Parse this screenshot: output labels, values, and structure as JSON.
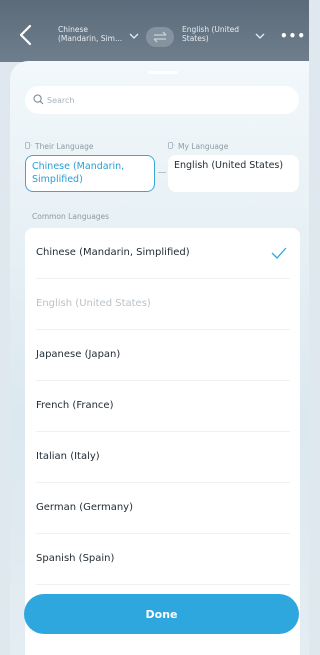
{
  "header": {
    "source_language": "Chinese (Mandarin, Sim...",
    "target_language": "English (United States)",
    "more_label": "•••"
  },
  "search": {
    "placeholder": "Search",
    "value": ""
  },
  "selection": {
    "their_label": "Their Language",
    "my_label": "My Language",
    "their_value": "Chinese (Mandarin, Simplified)",
    "my_value": "English (United States)"
  },
  "common_title": "Common Languages",
  "languages": [
    {
      "label": "Chinese (Mandarin, Simplified)",
      "selected": true,
      "disabled": false
    },
    {
      "label": "English (United States)",
      "selected": false,
      "disabled": true
    },
    {
      "label": "Japanese (Japan)",
      "selected": false,
      "disabled": false
    },
    {
      "label": "French (France)",
      "selected": false,
      "disabled": false
    },
    {
      "label": "Italian (Italy)",
      "selected": false,
      "disabled": false
    },
    {
      "label": "German (Germany)",
      "selected": false,
      "disabled": false
    },
    {
      "label": "Spanish (Spain)",
      "selected": false,
      "disabled": false
    }
  ],
  "done_label": "Done",
  "colors": {
    "accent": "#2ea7de",
    "topbar": "#5b6b7a"
  }
}
